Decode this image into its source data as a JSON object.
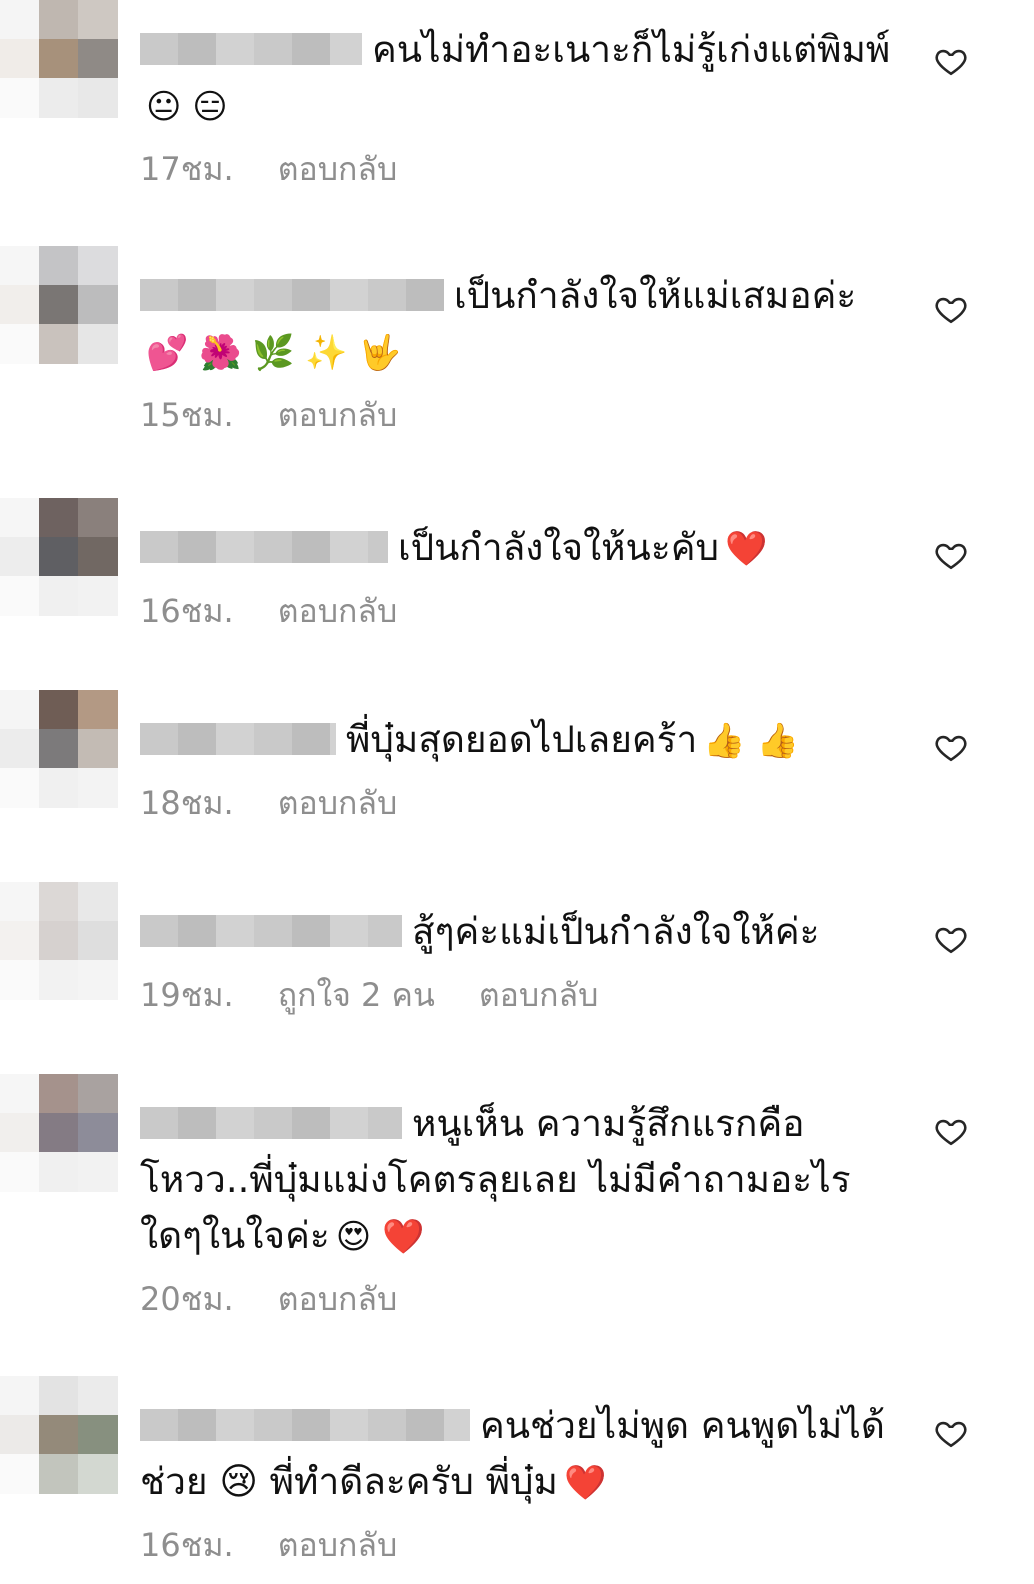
{
  "comments": [
    {
      "text": "คนไม่ทำอะเนาะก็ไม่รู้เก่งแต่พิมพ์",
      "emoji": "😐 😑",
      "time": "17ชม.",
      "likes": "",
      "reply": "ตอบกลับ"
    },
    {
      "text": "เป็นกำลังใจให้แม่เสมอค่ะ",
      "emoji": "💕 🌺 🌿 ✨ 🤟",
      "time": "15ชม.",
      "likes": "",
      "reply": "ตอบกลับ"
    },
    {
      "text": "เป็นกำลังใจให้นะคับ",
      "emoji": "❤️",
      "time": "16ชม.",
      "likes": "",
      "reply": "ตอบกลับ"
    },
    {
      "text": "พี่บุ๋มสุดยอดไปเลยคร้า",
      "emoji": "👍 👍",
      "time": "18ชม.",
      "likes": "",
      "reply": "ตอบกลับ"
    },
    {
      "text": "สู้ๆค่ะแม่เป็นกำลังใจให้ค่ะ",
      "emoji": "",
      "time": "19ชม.",
      "likes": "ถูกใจ 2 คน",
      "reply": "ตอบกลับ"
    },
    {
      "text": "หนูเห็น ความรู้สึกแรกคือ โหวว..พี่บุ๋มแม่งโคตรลุยเลย ไม่มีคำถามอะไรใดๆในใจค่ะ",
      "emoji": "😍 ❤️",
      "time": "20ชม.",
      "likes": "",
      "reply": "ตอบกลับ"
    },
    {
      "text": "คนช่วยไม่พูด คนพูดไม่ได้ช่วย 😢 พี่ทำดีละครับ พี่บุ๋ม",
      "emoji": "❤️",
      "time": "16ชม.",
      "likes": "",
      "reply": "ตอบกลับ"
    }
  ],
  "colors": {
    "meta": "#8e8e8e",
    "heart": "#262626"
  },
  "icons": {
    "like": "heart-outline-icon"
  }
}
